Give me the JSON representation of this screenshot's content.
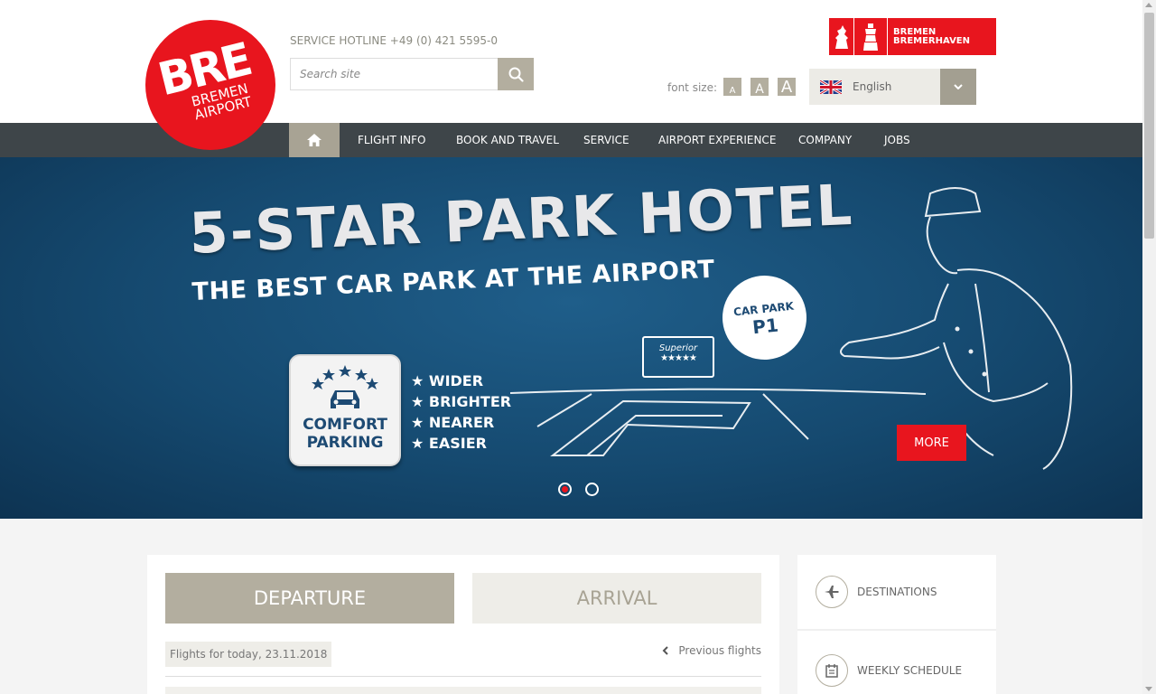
{
  "header": {
    "logo": {
      "main": "BRE",
      "line1": "BREMEN",
      "line2": "AIRPORT"
    },
    "hotline": "SERVICE HOTLINE +49 (0) 421 5595-0",
    "search": {
      "placeholder": "Search site",
      "icon": "search-icon"
    },
    "partner_logo": {
      "line1": "BREMEN",
      "line2": "BREMERHAVEN"
    },
    "font_size": {
      "label": "font size:",
      "small": "A",
      "medium": "A",
      "large": "A"
    },
    "language": {
      "selected": "English",
      "flag": "uk-flag-icon"
    }
  },
  "nav": {
    "home_icon": "home-icon",
    "items": [
      {
        "label": "FLIGHT INFO"
      },
      {
        "label": "BOOK AND TRAVEL"
      },
      {
        "label": "SERVICE"
      },
      {
        "label": "AIRPORT EXPERIENCE"
      },
      {
        "label": "COMPANY"
      },
      {
        "label": "JOBS"
      }
    ]
  },
  "hero": {
    "title": "5-STAR PARK HOTEL",
    "subtitle": "THE BEST CAR PARK AT THE AIRPORT",
    "badge": {
      "line1": "COMFORT",
      "line2": "PARKING"
    },
    "features": [
      "★ WIDER",
      "★ BRIGHTER",
      "★ NEARER",
      "★ EASIER"
    ],
    "car_park": {
      "label": "CAR PARK",
      "number": "P1"
    },
    "superior": {
      "label": "Superior",
      "stars": "★★★★★"
    },
    "more_label": "MORE",
    "slides": 2,
    "active_slide": 1
  },
  "flights": {
    "tabs": {
      "departure": "DEPARTURE",
      "arrival": "ARRIVAL"
    },
    "active_tab": "departure",
    "date_text": "Flights for today, 23.11.2018",
    "previous_label": "Previous flights"
  },
  "side": {
    "items": [
      {
        "label": "DESTINATIONS",
        "icon": "plane-icon"
      },
      {
        "label": "WEEKLY SCHEDULE",
        "icon": "calendar-icon"
      }
    ]
  },
  "colors": {
    "brand_red": "#e8151e",
    "accent_taupe": "#b3ae9f",
    "nav_dark": "#3e4549",
    "hero_blue": "#15496f"
  }
}
